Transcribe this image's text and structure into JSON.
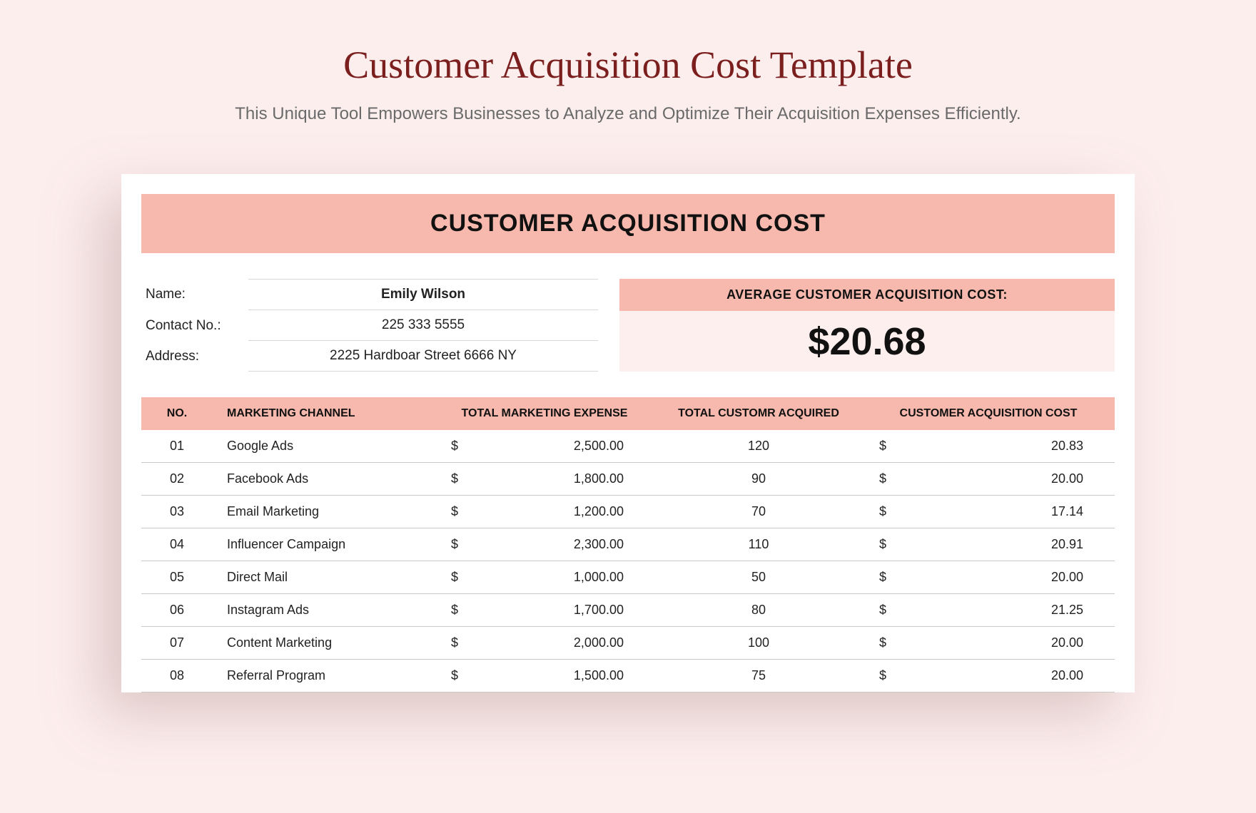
{
  "page": {
    "title": "Customer Acquisition Cost Template",
    "subtitle": "This Unique Tool Empowers Businesses to Analyze and Optimize Their Acquisition Expenses Efficiently."
  },
  "doc": {
    "title": "CUSTOMER ACQUISITION COST",
    "meta": {
      "name_label": "Name:",
      "name_value": "Emily Wilson",
      "contact_label": "Contact No.:",
      "contact_value": "225 333 5555",
      "address_label": "Address:",
      "address_value": "2225 Hardboar Street 6666 NY"
    },
    "avg": {
      "label": "AVERAGE CUSTOMER ACQUISITION COST:",
      "value": "$20.68"
    }
  },
  "table": {
    "headers": {
      "no": "NO.",
      "channel": "MARKETING CHANNEL",
      "expense": "TOTAL MARKETING EXPENSE",
      "acquired": "TOTAL CUSTOMR ACQUIRED",
      "cac": "CUSTOMER ACQUISITION COST"
    },
    "currency": "$",
    "rows": [
      {
        "no": "01",
        "channel": "Google Ads",
        "expense": "2,500.00",
        "acquired": "120",
        "cac": "20.83"
      },
      {
        "no": "02",
        "channel": "Facebook Ads",
        "expense": "1,800.00",
        "acquired": "90",
        "cac": "20.00"
      },
      {
        "no": "03",
        "channel": "Email Marketing",
        "expense": "1,200.00",
        "acquired": "70",
        "cac": "17.14"
      },
      {
        "no": "04",
        "channel": "Influencer Campaign",
        "expense": "2,300.00",
        "acquired": "110",
        "cac": "20.91"
      },
      {
        "no": "05",
        "channel": "Direct Mail",
        "expense": "1,000.00",
        "acquired": "50",
        "cac": "20.00"
      },
      {
        "no": "06",
        "channel": "Instagram Ads",
        "expense": "1,700.00",
        "acquired": "80",
        "cac": "21.25"
      },
      {
        "no": "07",
        "channel": "Content Marketing",
        "expense": "2,000.00",
        "acquired": "100",
        "cac": "20.00"
      },
      {
        "no": "08",
        "channel": "Referral Program",
        "expense": "1,500.00",
        "acquired": "75",
        "cac": "20.00"
      }
    ]
  }
}
